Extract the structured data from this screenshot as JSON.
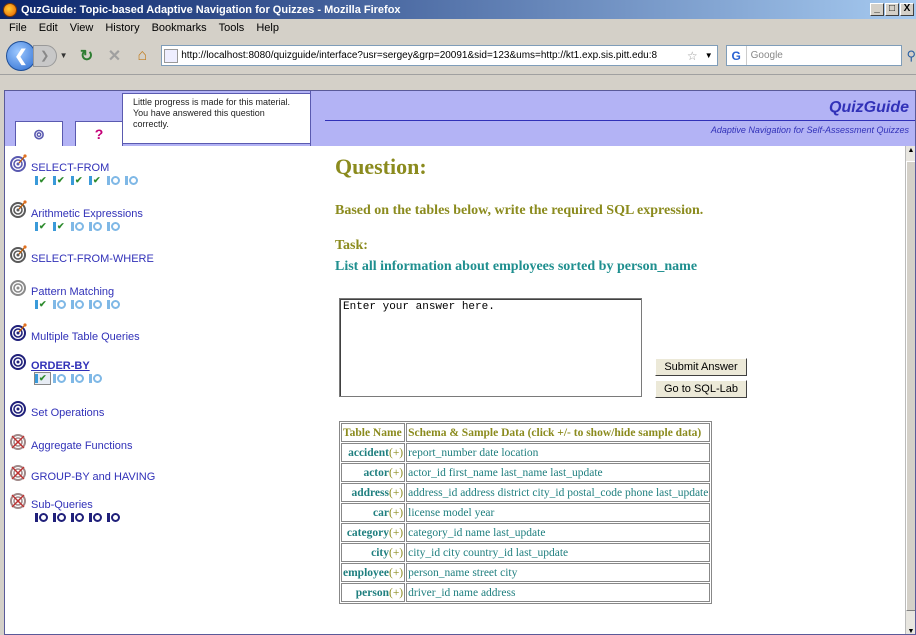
{
  "window": {
    "title": "QuzGuide: Topic-based Adaptive Navigation for Quizzes - Mozilla Firefox",
    "min": "_",
    "max": "□",
    "close": "X"
  },
  "menu": [
    "File",
    "Edit",
    "View",
    "History",
    "Bookmarks",
    "Tools",
    "Help"
  ],
  "toolbar": {
    "url": "http://localhost:8080/quizguide/interface?usr=sergey&grp=20091&sid=123&ums=http://kt1.exp.sis.pitt.edu:8",
    "search_placeholder": "Google"
  },
  "header": {
    "tab1": "⊚",
    "tab2": "?",
    "tip": "Little progress is made for this material. You have answered this question correctly.",
    "brand": "QuizGuide",
    "subtitle": "Adaptive Navigation for Self-Assessment Quizzes"
  },
  "topics": [
    {
      "label": "SELECT-FROM",
      "target": "#5a5ab0",
      "flag": true,
      "bold": false,
      "questions": [
        "done",
        "done",
        "done",
        "done",
        "open",
        "open"
      ]
    },
    {
      "label": "Arithmetic Expressions",
      "target": "#5a5a5a",
      "flag": true,
      "bold": false,
      "questions": [
        "done",
        "done",
        "open",
        "open",
        "open"
      ]
    },
    {
      "label": "SELECT-FROM-WHERE",
      "target": "#5a5a5a",
      "flag": true,
      "bold": false,
      "questions": []
    },
    {
      "label": "Pattern Matching",
      "target": "#8a8a8a",
      "flag": false,
      "bold": false,
      "questions": [
        "done",
        "open",
        "open",
        "open",
        "open"
      ]
    },
    {
      "label": "Multiple Table Queries",
      "target": "#20207a",
      "flag": true,
      "bold": false,
      "questions": []
    },
    {
      "label": "ORDER-BY",
      "target": "#20207a",
      "flag": false,
      "bold": true,
      "questions": [
        "sel",
        "open",
        "open",
        "open"
      ]
    },
    {
      "label": "Set Operations",
      "target": "#20207a",
      "flag": false,
      "bold": false,
      "questions": []
    },
    {
      "label": "Aggregate Functions",
      "target": "#a08888",
      "flag": false,
      "bold": false,
      "crossed": true,
      "questions": []
    },
    {
      "label": "GROUP-BY and HAVING",
      "target": "#a08888",
      "flag": false,
      "bold": false,
      "crossed": true,
      "questions": []
    },
    {
      "label": "Sub-Queries",
      "target": "#a08888",
      "flag": false,
      "bold": false,
      "crossed": true,
      "questions": [
        "locked",
        "locked",
        "locked",
        "locked",
        "locked"
      ]
    }
  ],
  "question": {
    "title": "Question:",
    "instruction": "Based on the tables below, write the required SQL expression.",
    "task_label": "Task:",
    "task_text": "List all information about employees sorted by person_name",
    "answer_placeholder": "Enter your answer here.",
    "submit": "Submit Answer",
    "sqllab": "Go to SQL-Lab"
  },
  "schema": {
    "header_name": "Table Name",
    "header_schema": "Schema & Sample Data (click +/- to show/hide sample data)",
    "plus": "(+)",
    "rows": [
      {
        "name": "accident",
        "cols": "report_number date location"
      },
      {
        "name": "actor",
        "cols": "actor_id first_name last_name last_update"
      },
      {
        "name": "address",
        "cols": "address_id address district city_id postal_code phone last_update"
      },
      {
        "name": "car",
        "cols": "license model year"
      },
      {
        "name": "category",
        "cols": "category_id name last_update"
      },
      {
        "name": "city",
        "cols": "city_id city country_id last_update"
      },
      {
        "name": "employee",
        "cols": "person_name street city"
      },
      {
        "name": "person",
        "cols": "driver_id name address"
      }
    ]
  },
  "colors": {
    "accent": "#3131b8",
    "olive": "#8b8b1e",
    "teal": "#1f7f7f",
    "header_bg": "#b3b3f5"
  }
}
